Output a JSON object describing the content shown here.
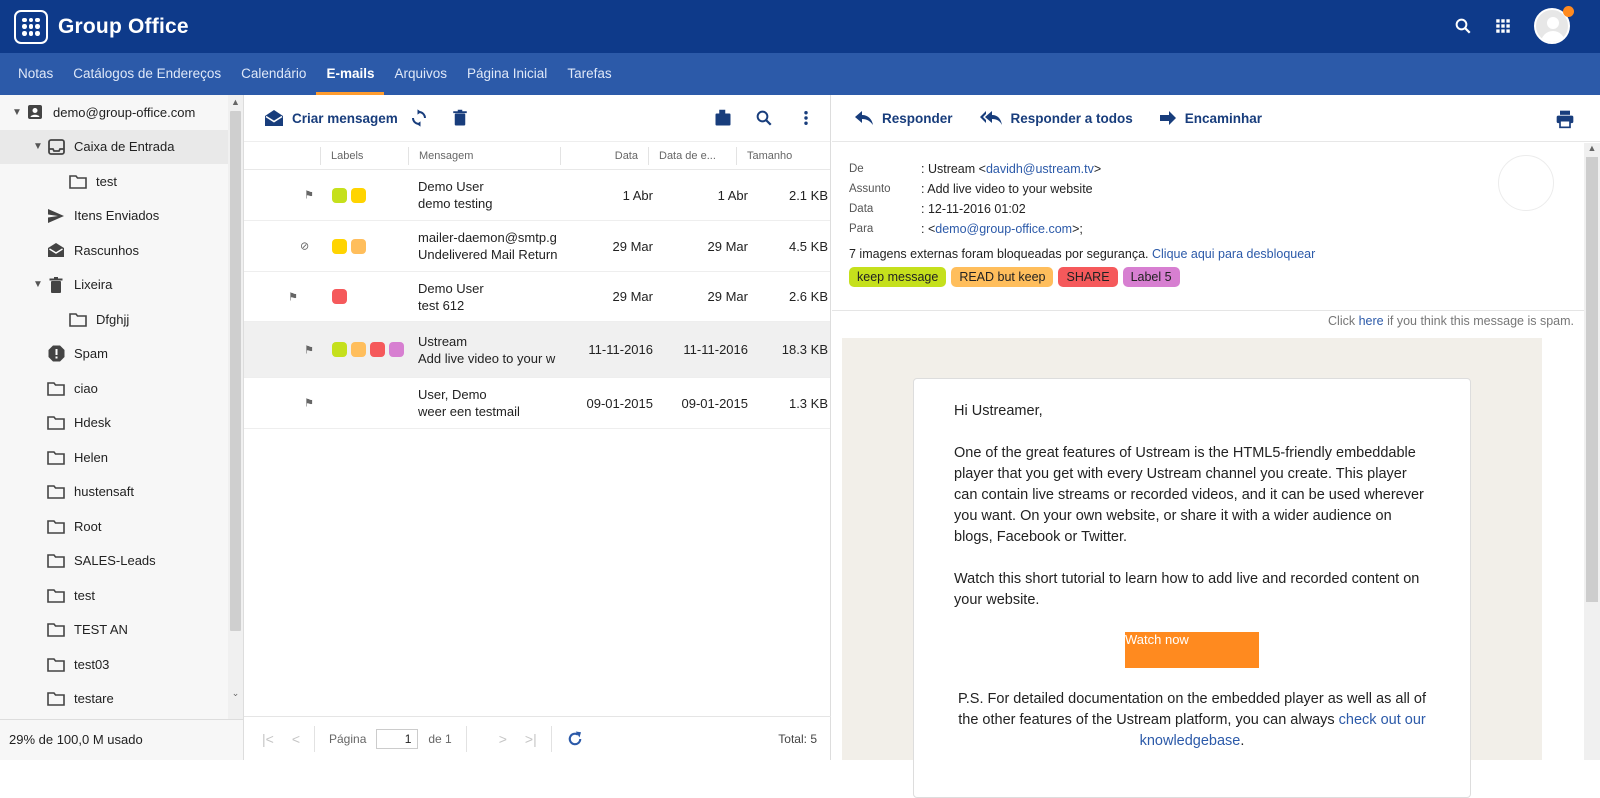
{
  "app": {
    "name": "Group Office"
  },
  "nav": {
    "tabs": [
      "Notas",
      "Catálogos de Endereços",
      "Calendário",
      "E-mails",
      "Arquivos",
      "Página Inicial",
      "Tarefas"
    ],
    "active": "E-mails"
  },
  "sidebar": {
    "account": "demo@group-office.com",
    "folders": {
      "inbox": "Caixa de Entrada",
      "inbox_sub": "test",
      "sent": "Itens Enviados",
      "drafts": "Rascunhos",
      "trash": "Lixeira",
      "trash_sub": "Dfghjj",
      "spam": "Spam",
      "ciao": "ciao",
      "hdesk": "Hdesk",
      "helen": "Helen",
      "hustensaft": "hustensaft",
      "root": "Root",
      "sales": "SALES-Leads",
      "test": "test",
      "test_an": "TEST AN",
      "test03": "test03",
      "testare": "testare"
    },
    "quota": "29% de 100,0 M usado"
  },
  "list": {
    "compose_label": "Criar mensagem",
    "columns": {
      "labels": "Labels",
      "message": "Mensagem",
      "date": "Data",
      "received": "Data de e...",
      "size": "Tamanho"
    },
    "rows": [
      {
        "from": "Demo User",
        "subject": "demo testing",
        "date": "1 Abr",
        "received": "1 Abr",
        "size": "2.1 KB"
      },
      {
        "from": "mailer-daemon@smtp.g",
        "subject": "Undelivered Mail Return",
        "date": "29 Mar",
        "received": "29 Mar",
        "size": "4.5 KB"
      },
      {
        "from": "Demo User",
        "subject": "test 612",
        "date": "29 Mar",
        "received": "29 Mar",
        "size": "2.6 KB"
      },
      {
        "from": "Ustream",
        "subject": "Add live video to your w",
        "date": "11-11-2016",
        "received": "11-11-2016",
        "size": "18.3 KB"
      },
      {
        "from": "User, Demo",
        "subject": "weer een testmail",
        "date": "09-01-2015",
        "received": "09-01-2015",
        "size": "1.3 KB"
      }
    ],
    "pager": {
      "page_label": "Página",
      "page": "1",
      "of": "de 1",
      "total": "Total: 5"
    }
  },
  "reader": {
    "actions": {
      "reply": "Responder",
      "reply_all": "Responder a todos",
      "forward": "Encaminhar"
    },
    "header": {
      "from_key": "De",
      "from_name": ": Ustream <",
      "from_email": "davidh@ustream.tv",
      "from_end": ">",
      "subject_key": "Assunto",
      "subject": ": Add live video to your website",
      "date_key": "Data",
      "date": ": 12-11-2016 01:02",
      "to_key": "Para",
      "to_pre": ": <",
      "to_email": "demo@group-office.com",
      "to_end": ">;"
    },
    "blocked_text": "7 imagens externas foram bloqueadas por segurança.",
    "blocked_link": "Clique aqui para desbloquear",
    "tags": [
      {
        "label": "keep message",
        "color": "#c5e01c"
      },
      {
        "label": "READ but keep",
        "color": "#ffbe5c"
      },
      {
        "label": "SHARE",
        "color": "#f5595b"
      },
      {
        "label": "Label 5",
        "color": "#d77fd1"
      }
    ],
    "spam": {
      "pre": "Click",
      "link": "here",
      "post": "if you think this message is spam."
    },
    "body": {
      "greeting": "Hi Ustreamer,",
      "p1": "One of the great features of Ustream is the HTML5-friendly embeddable player that you get with every Ustream channel you create. This player can contain live streams or recorded videos, and it can be used wherever you want. On your own website, or share it with a wider audience on blogs, Facebook or Twitter.",
      "p2": "Watch this short tutorial to learn how to add live and recorded content on your website.",
      "button": "Watch now",
      "ps": "P.S. For detailed documentation on the embedded player as well as all of the other features of the Ustream platform, you can always",
      "ps_link": "check out our knowledgebase",
      "ps_end": "."
    }
  },
  "colors": {
    "topbar": "#0e3a8a",
    "navbar": "#2c5aa9",
    "accent": "#ff9c2e",
    "label_lime": "#c5e01c",
    "label_yellow": "#ffd400",
    "label_orange": "#ffbe5c",
    "label_red": "#f5595b",
    "label_purple": "#d77fd1"
  }
}
